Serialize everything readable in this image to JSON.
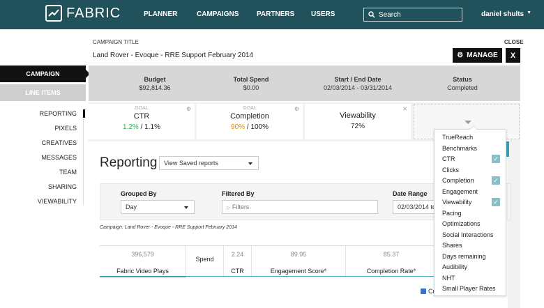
{
  "app": {
    "brand": "FABRIC"
  },
  "nav": {
    "links": [
      "PLANNER",
      "CAMPAIGNS",
      "PARTNERS",
      "USERS"
    ],
    "search_placeholder": "Search",
    "user": "daniel shults"
  },
  "header": {
    "label": "CAMPAIGN TITLE",
    "title": "Land Rover - Evoque - RRE Support February 2014",
    "close": "CLOSE",
    "manage": "MANAGE",
    "x": "X"
  },
  "leftnav": {
    "campaign": "CAMPAIGN",
    "line_items": "LINE ITEMS",
    "sub": [
      "REPORTING",
      "PIXELS",
      "CREATIVES",
      "MESSAGES",
      "TEAM",
      "SHARING",
      "VIEWABILITY"
    ]
  },
  "summary": [
    {
      "title": "Budget",
      "value": "$92,814.36"
    },
    {
      "title": "Total Spend",
      "value": "$0.00"
    },
    {
      "title": "Start / End Date",
      "value": "02/03/2014 - 03/31/2014"
    },
    {
      "title": "Status",
      "value": "Completed"
    }
  ],
  "goals": [
    {
      "label": "GOAL",
      "name": "CTR",
      "value_hi": "1.2%",
      "value_rest": " / 1.1%",
      "hi_color": "#2bb24c"
    },
    {
      "label": "GOAL",
      "name": "Completion",
      "value_hi": "90%",
      "value_rest": " / 100%",
      "hi_color": "#d98b00"
    },
    {
      "label": "",
      "name": "Viewability",
      "value_hi": "",
      "value_rest": "72%",
      "hi_color": "#222"
    }
  ],
  "reporting": {
    "title": "Reporting",
    "saved": "View Saved reports",
    "grouped_label": "Grouped By",
    "grouped_value": "Day",
    "filtered_label": "Filtered By",
    "filtered_placeholder": "Filters",
    "date_label": "Date Range",
    "date_value": "02/03/2014 to",
    "campaign_note": "Campaign: Land Rover - Evoque - RRE Support February 2014"
  },
  "metrics": [
    {
      "value": "396,579",
      "name": "Fabric Video Plays"
    },
    {
      "value": "",
      "name": "Spend"
    },
    {
      "value": "2.24",
      "name": "CTR"
    },
    {
      "value": "89.95",
      "name": "Engagement Score*"
    },
    {
      "value": "85.37",
      "name": "Completion Rate*"
    }
  ],
  "cu_label": "Cu",
  "dropdown": {
    "items": [
      {
        "label": "TrueReach",
        "checked": false
      },
      {
        "label": "Benchmarks",
        "checked": false
      },
      {
        "label": "CTR",
        "checked": true
      },
      {
        "label": "Clicks",
        "checked": false
      },
      {
        "label": "Completion",
        "checked": true
      },
      {
        "label": "Engagement",
        "checked": false
      },
      {
        "label": "Viewability",
        "checked": true
      },
      {
        "label": "Pacing",
        "checked": false
      },
      {
        "label": "Optimizations",
        "checked": false
      },
      {
        "label": "Social Interactions",
        "checked": false
      },
      {
        "label": "Shares",
        "checked": false
      },
      {
        "label": "Days remaining",
        "checked": false
      },
      {
        "label": "Audibility",
        "checked": false
      },
      {
        "label": "NHT",
        "checked": false
      },
      {
        "label": "Small Player Rates",
        "checked": false
      }
    ]
  }
}
